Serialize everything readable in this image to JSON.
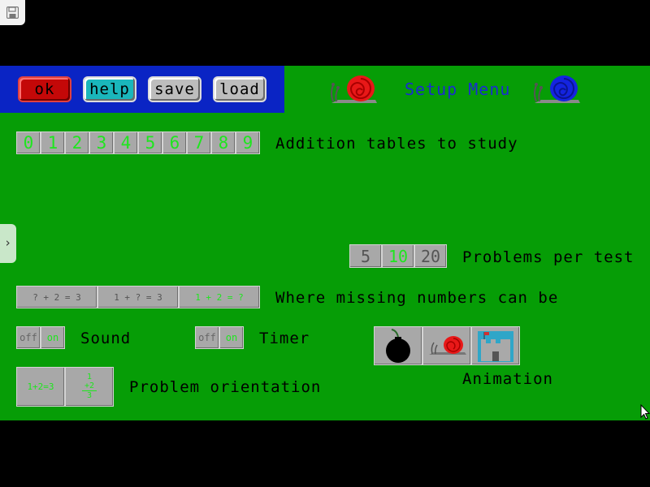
{
  "toolbar": {
    "ok": "ok",
    "help": "help",
    "save": "save",
    "load": "load"
  },
  "title": "Setup Menu",
  "addition": {
    "digits": [
      "0",
      "1",
      "2",
      "3",
      "4",
      "5",
      "6",
      "7",
      "8",
      "9"
    ],
    "label": "Addition tables to study"
  },
  "problems": {
    "options": [
      "5",
      "10",
      "20"
    ],
    "selected": "10",
    "label": "Problems per test"
  },
  "missing": {
    "options": [
      "? + 2 = 3",
      "1 + ? = 3",
      "1 + 2 = ?"
    ],
    "label": "Where missing numbers can be"
  },
  "sound": {
    "off": "off",
    "on": "on",
    "label": "Sound"
  },
  "timer": {
    "off": "off",
    "on": "on",
    "label": "Timer"
  },
  "orientation": {
    "horizontal": "1+2=3",
    "vertical": [
      "1",
      "+2",
      "3"
    ],
    "label": "Problem orientation"
  },
  "animation": {
    "label": "Animation",
    "options": [
      "bomb-icon",
      "snail-icon",
      "castle-icon"
    ]
  },
  "colors": {
    "background": "#069d06",
    "toolbar": "#0a24c4",
    "title": "#1a2cd2",
    "highlight": "#1ee61e",
    "ok_button": "#c40808",
    "help_button": "#1ab6bb"
  }
}
